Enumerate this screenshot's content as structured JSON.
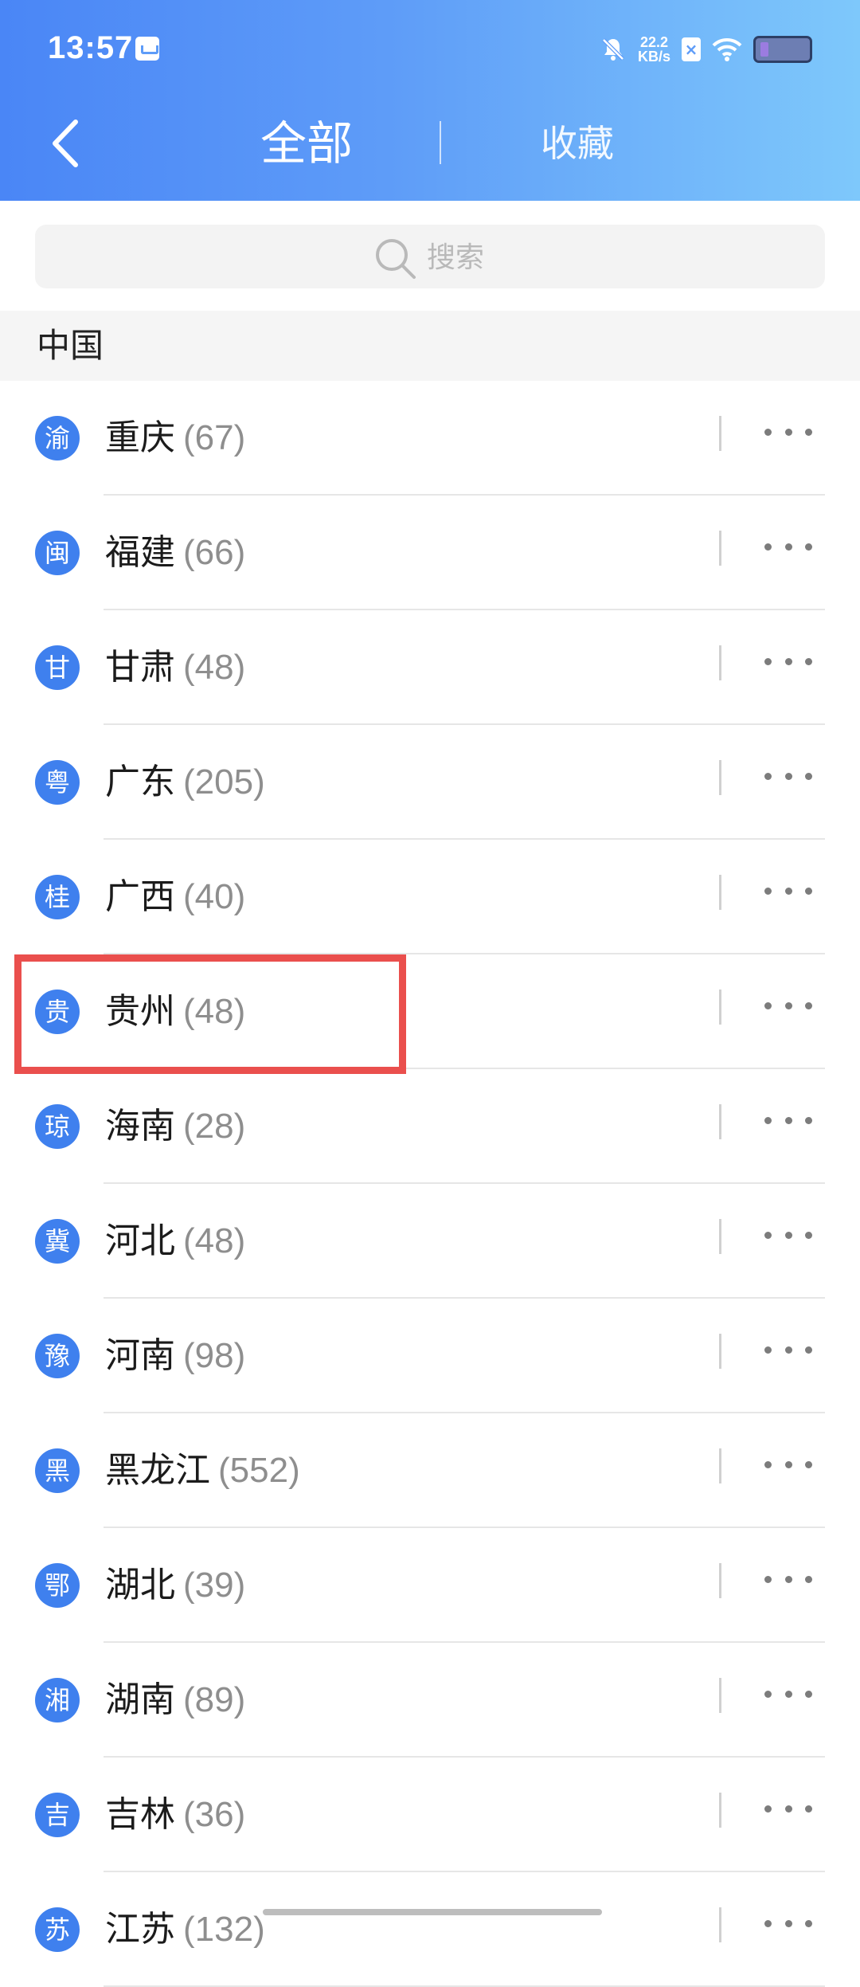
{
  "status_bar": {
    "time": "13:57",
    "net_speed_value": "22.2",
    "net_speed_unit": "KB/s"
  },
  "header": {
    "tab_all": "全部",
    "tab_favorites": "收藏"
  },
  "search": {
    "placeholder": "搜索"
  },
  "section": {
    "title": "中国"
  },
  "rows": [
    {
      "badge": "渝",
      "name": "重庆",
      "count": "(67)"
    },
    {
      "badge": "闽",
      "name": "福建",
      "count": "(66)"
    },
    {
      "badge": "甘",
      "name": "甘肃",
      "count": "(48)"
    },
    {
      "badge": "粤",
      "name": "广东",
      "count": "(205)"
    },
    {
      "badge": "桂",
      "name": "广西",
      "count": "(40)"
    },
    {
      "badge": "贵",
      "name": "贵州",
      "count": "(48)"
    },
    {
      "badge": "琼",
      "name": "海南",
      "count": "(28)"
    },
    {
      "badge": "冀",
      "name": "河北",
      "count": "(48)"
    },
    {
      "badge": "豫",
      "name": "河南",
      "count": "(98)"
    },
    {
      "badge": "黑",
      "name": "黑龙江",
      "count": "(552)"
    },
    {
      "badge": "鄂",
      "name": "湖北",
      "count": "(39)"
    },
    {
      "badge": "湘",
      "name": "湖南",
      "count": "(89)"
    },
    {
      "badge": "吉",
      "name": "吉林",
      "count": "(36)"
    },
    {
      "badge": "苏",
      "name": "江苏",
      "count": "(132)"
    }
  ],
  "colors": {
    "header_start": "#4a86f6",
    "header_end": "#7ec8fb",
    "badge": "#3f80ee",
    "highlight": "#ea4f4d"
  }
}
